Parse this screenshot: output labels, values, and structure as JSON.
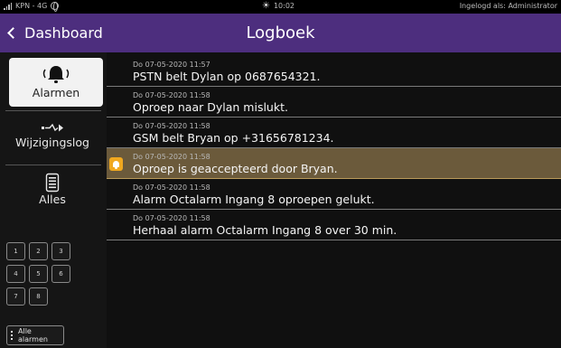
{
  "statusbar": {
    "carrier": "KPN - 4G",
    "time": "10:02",
    "login": "Ingelogd als: Administrator"
  },
  "header": {
    "back_label": "Dashboard",
    "title": "Logboek"
  },
  "sidebar": {
    "items": [
      {
        "label": "Alarmen",
        "icon": "alarm-bell-icon",
        "active": true
      },
      {
        "label": "Wijzigingslog",
        "icon": "signal-change-icon",
        "active": false
      },
      {
        "label": "Alles",
        "icon": "document-icon",
        "active": false
      }
    ],
    "keys": [
      "1",
      "2",
      "3",
      "4",
      "5",
      "6",
      "7",
      "8"
    ],
    "all_alarms_label": "Alle alarmen"
  },
  "log": {
    "entries": [
      {
        "date": "Do 07-05-2020 11:57",
        "text": "PSTN belt Dylan op 0687654321.",
        "highlight": false
      },
      {
        "date": "Do 07-05-2020 11:58",
        "text": "Oproep naar Dylan mislukt.",
        "highlight": false
      },
      {
        "date": "Do 07-05-2020 11:58",
        "text": "GSM belt Bryan op +31656781234.",
        "highlight": false
      },
      {
        "date": "Do 07-05-2020 11:58",
        "text": "Oproep is geaccepteerd door Bryan.",
        "highlight": true
      },
      {
        "date": "Do 07-05-2020 11:58",
        "text": "Alarm Octalarm Ingang 8 oproepen gelukt.",
        "highlight": false
      },
      {
        "date": "Do 07-05-2020 11:58",
        "text": "Herhaal alarm Octalarm Ingang 8 over 30 min.",
        "highlight": false
      }
    ]
  },
  "colors": {
    "header": "#4d2e7e",
    "highlight_row": "#6b5a3b",
    "alarm_badge": "#f0a820"
  }
}
